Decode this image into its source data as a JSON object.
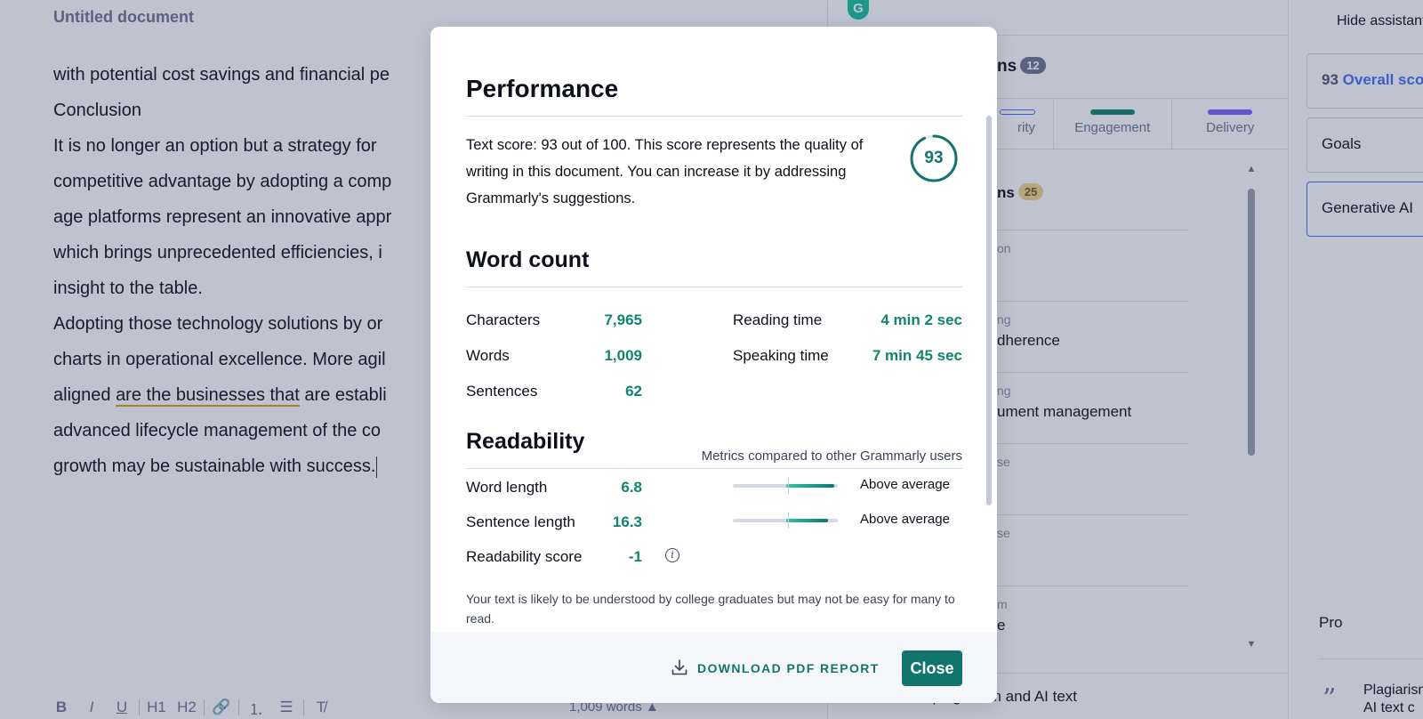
{
  "editor": {
    "title": "Untitled document",
    "lines": [
      "with potential cost savings and financial pe",
      "Conclusion",
      "It is no longer an option but a strategy for",
      "competitive advantage by adopting a comp",
      "age platforms represent an innovative appr",
      "which brings unprecedented efficiencies, i",
      "insight to the table.",
      "Adopting those technology solutions by or",
      "charts in operational excellence. More agil",
      "aligned ",
      "growth may be sustainable with success."
    ],
    "underlined_phrase": "are the businesses that",
    "after_underline": " are establi",
    "line_11": "advanced lifecycle management of the co",
    "word_count_status": "1,009 words ▲",
    "format_buttons": [
      "B",
      "I",
      "U",
      "H1",
      "H2",
      "🔗",
      "⒈",
      "☰",
      "T̸"
    ]
  },
  "assistant": {
    "logo": "G",
    "suggestions_title": "ns",
    "suggestions_count": "12",
    "tabs": [
      {
        "label": "rity",
        "color": "#4a6cf7"
      },
      {
        "label": "Engagement",
        "color": "#11856e"
      },
      {
        "label": "Delivery",
        "color": "#7b61ff"
      }
    ],
    "all_title": "ns",
    "all_count": "25",
    "items": [
      {
        "category": "on",
        "text": ""
      },
      {
        "category": "ng",
        "text": "dherence"
      },
      {
        "category": "ng",
        "text": "ument management"
      },
      {
        "category": "se",
        "text": ""
      },
      {
        "category": "se",
        "text": ""
      },
      {
        "category": "m",
        "text": "e"
      }
    ],
    "plagiarism_row": "Check for plagiarism and AI text"
  },
  "scorepanel": {
    "hide_assistant": "Hide assistant",
    "overall_score": "93",
    "overall_label": "Overall score",
    "goals": "Goals",
    "generative_ai": "Generative AI",
    "pro": "Pro",
    "plagiarism_line1": "Plagiarism",
    "plagiarism_line2": "AI text c"
  },
  "modal": {
    "performance_title": "Performance",
    "performance_text": "Text score: 93 out of 100. This score represents the quality of writing in this document. You can increase it by addressing Grammarly's suggestions.",
    "score": "93",
    "score_fraction": 0.93,
    "word_count_title": "Word count",
    "stats_left": [
      {
        "label": "Characters",
        "value": "7,965"
      },
      {
        "label": "Words",
        "value": "1,009"
      },
      {
        "label": "Sentences",
        "value": "62"
      }
    ],
    "stats_right": [
      {
        "label": "Reading time",
        "value": "4 min 2 sec"
      },
      {
        "label": "Speaking time",
        "value": "7 min 45 sec"
      }
    ],
    "readability_title": "Readability",
    "readability_caption": "Metrics compared to other Grammarly users",
    "readability_metrics": [
      {
        "label": "Word length",
        "value": "6.8",
        "rating": "Above average",
        "bar_start": 0.51,
        "bar_end": 0.97
      },
      {
        "label": "Sentence length",
        "value": "16.3",
        "rating": "Above average",
        "bar_start": 0.51,
        "bar_end": 0.91
      }
    ],
    "readability_score_label": "Readability score",
    "readability_score_value": "-1",
    "readability_note": "Your text is likely to be understood by college graduates but may not be easy for many to read.",
    "download_label": "DOWNLOAD PDF REPORT",
    "close_label": "Close"
  },
  "colors": {
    "accent_green": "#11756e",
    "value_green": "#11856e",
    "overlay": "rgba(42,55,98,0.30)",
    "underline": "#e3a008"
  }
}
